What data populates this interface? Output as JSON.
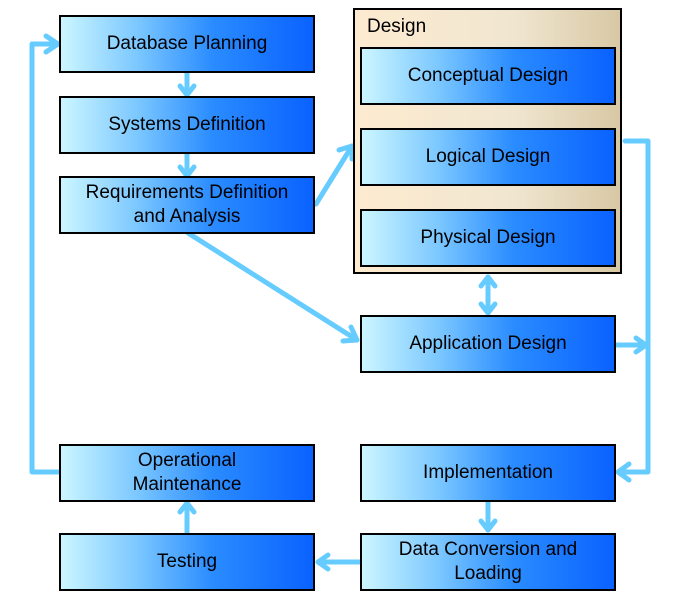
{
  "diagram": {
    "design_group_label": "Design",
    "boxes": {
      "database_planning": "Database Planning",
      "systems_definition": "Systems Definition",
      "requirements_line1": "Requirements Definition",
      "requirements_line2": "and Analysis",
      "conceptual_design": "Conceptual Design",
      "logical_design": "Logical Design",
      "physical_design": "Physical Design",
      "application_design": "Application Design",
      "implementation": "Implementation",
      "data_conversion_line1": "Data Conversion and",
      "data_conversion_line2": "Loading",
      "testing": "Testing",
      "operational_line1": "Operational",
      "operational_line2": "Maintenance"
    },
    "colors": {
      "arrow": "#66ccff",
      "box_gradient_start": "#ccf6ff",
      "box_gradient_end": "#0a62ff",
      "group_background": "#f0e6d0"
    }
  }
}
